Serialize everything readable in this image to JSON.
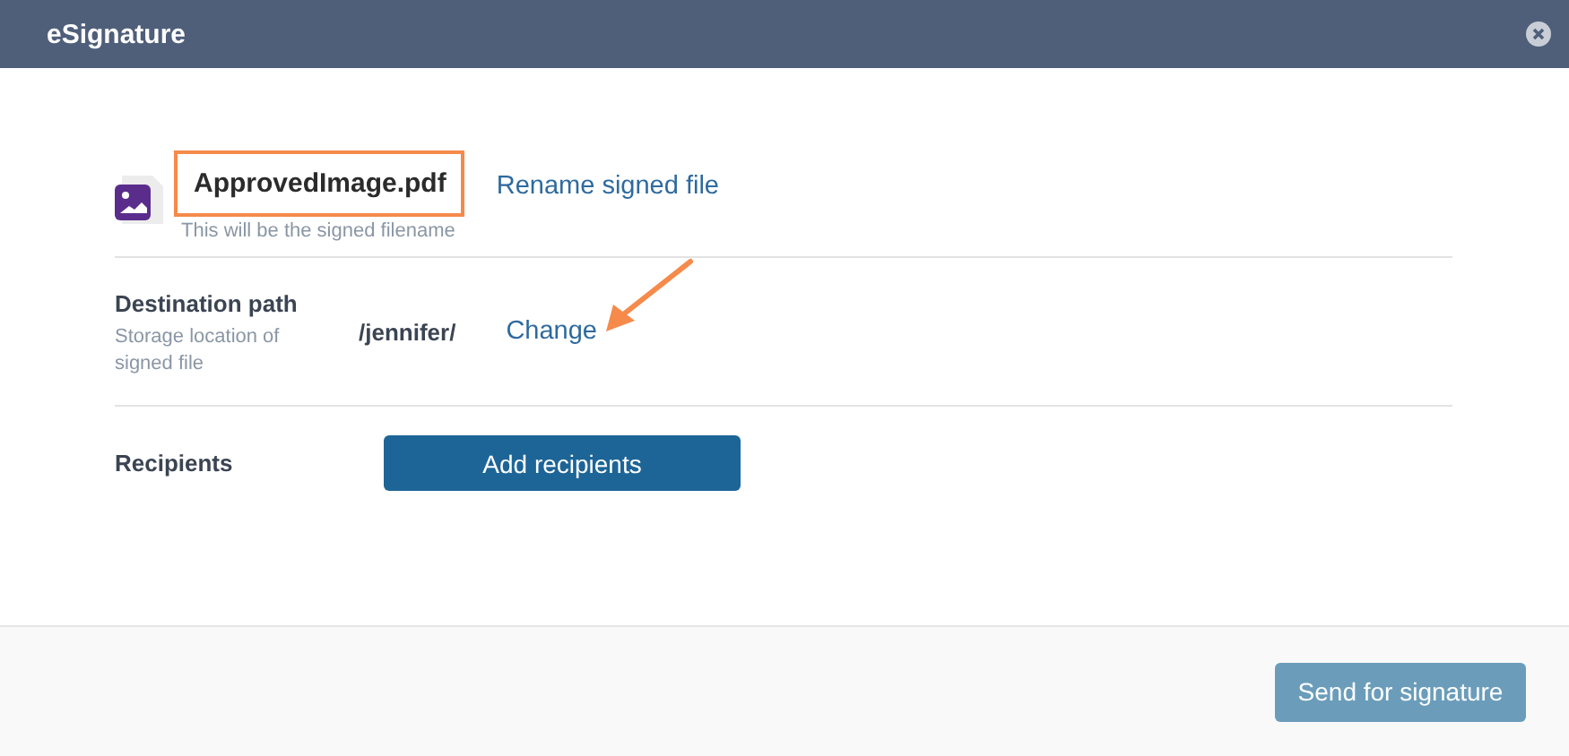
{
  "window": {
    "title": "eSignature"
  },
  "file": {
    "name": "ApprovedImage.pdf",
    "hint": "This will be the signed filename",
    "highlighted": true,
    "rename_link": "Rename signed file"
  },
  "destination": {
    "label": "Destination path",
    "hint": "Storage location of signed file",
    "path": "/jennifer/",
    "change_link": "Change",
    "arrow": true
  },
  "recipients": {
    "label": "Recipients",
    "button": "Add recipients"
  },
  "footer": {
    "button": {
      "label": "Send for signature",
      "disabled": true
    }
  }
}
